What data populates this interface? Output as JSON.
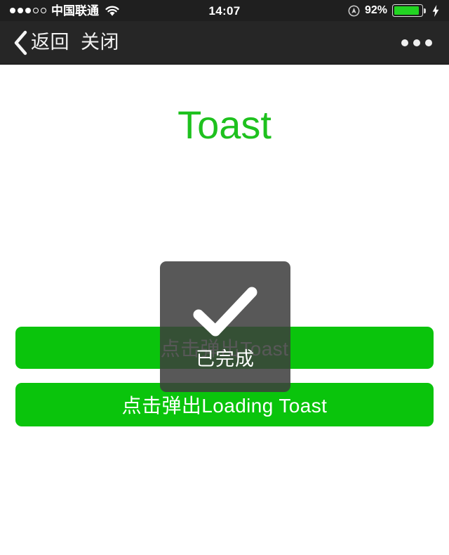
{
  "status_bar": {
    "signal_dots_filled": 3,
    "signal_dots_total": 5,
    "carrier": "中国联通",
    "wifi_icon": "wifi-icon",
    "time": "14:07",
    "location_icon": "location-services-icon",
    "battery_percent": "92%",
    "battery_level": 92,
    "battery_color": "#22d422",
    "charging_icon": "lightning-bolt-icon"
  },
  "nav_bar": {
    "back_icon": "chevron-left-icon",
    "back_label": "返回",
    "close_label": "关闭",
    "more_icon": "more-horizontal-icon"
  },
  "page": {
    "title": "Toast",
    "title_color": "#1ec11e",
    "button_color": "#0ac40c",
    "buttons": [
      {
        "label": "点击弹出Toast",
        "name": "show-toast-button"
      },
      {
        "label": "点击弹出Loading Toast",
        "name": "show-loading-toast-button"
      }
    ]
  },
  "toast": {
    "visible": true,
    "icon": "check-mark-icon",
    "label": "已完成",
    "background_color": "rgba(60,60,60,0.86)"
  }
}
